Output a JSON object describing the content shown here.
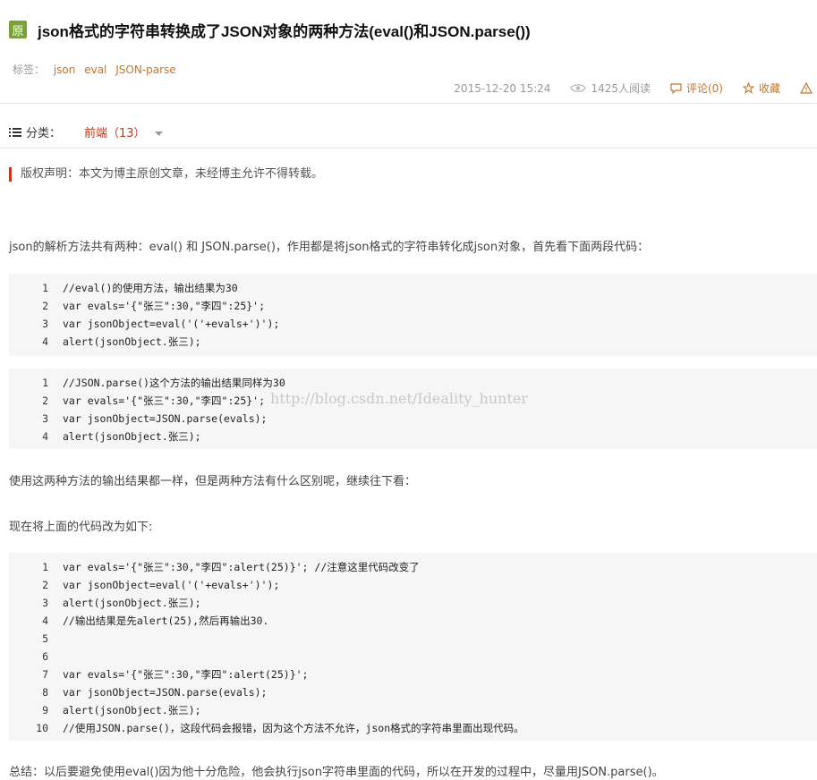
{
  "article": {
    "badge": "原",
    "title": "json格式的字符串转换成了JSON对象的两种方法(eval()和JSON.parse())",
    "tags_label": "标签：",
    "tags": [
      "json",
      "eval",
      "JSON-parse"
    ],
    "date": "2015-12-20 15:24",
    "reads": "1425人阅读",
    "comments": "评论(0)",
    "favorite": "收藏",
    "category_label": "分类：",
    "category_value": "前端（13）",
    "copyright": "版权声明：本文为博主原创文章，未经博主允许不得转载。",
    "para1": "json的解析方法共有两种：eval() 和 JSON.parse()，作用都是将json格式的字符串转化成json对象，首先看下面两段代码：",
    "para2": "使用这两种方法的输出结果都一样，但是两种方法有什么区别呢，继续往下看：",
    "para3": "现在将上面的代码改为如下:",
    "summary": "总结：以后要避免使用eval()因为他十分危险，他会执行json字符串里面的代码，所以在开发的过程中，尽量用JSON.parse()。",
    "watermark": "http://blog.csdn.net/Ideality_hunter"
  },
  "code1": [
    {
      "n": "1",
      "t": "//eval()的使用方法，输出结果为30"
    },
    {
      "n": "2",
      "t": "var evals='{\"张三\":30,\"李四\":25}';"
    },
    {
      "n": "3",
      "t": "var jsonObject=eval('('+evals+')');"
    },
    {
      "n": "4",
      "t": "alert(jsonObject.张三);"
    }
  ],
  "code2": [
    {
      "n": "1",
      "t": "//JSON.parse()这个方法的输出结果同样为30"
    },
    {
      "n": "2",
      "t": "var evals='{\"张三\":30,\"李四\":25}';"
    },
    {
      "n": "3",
      "t": "var jsonObject=JSON.parse(evals);"
    },
    {
      "n": "4",
      "t": "alert(jsonObject.张三);"
    }
  ],
  "code3": [
    {
      "n": "1",
      "t": "var evals='{\"张三\":30,\"李四\":alert(25)}'; //注意这里代码改变了"
    },
    {
      "n": "2",
      "t": "var jsonObject=eval('('+evals+')');"
    },
    {
      "n": "3",
      "t": "alert(jsonObject.张三);"
    },
    {
      "n": "4",
      "t": "//输出结果是先alert(25),然后再输出30."
    },
    {
      "n": "5",
      "t": ""
    },
    {
      "n": "6",
      "t": ""
    },
    {
      "n": "7",
      "t": "var evals='{\"张三\":30,\"李四\":alert(25)}';"
    },
    {
      "n": "8",
      "t": "var jsonObject=JSON.parse(evals);"
    },
    {
      "n": "9",
      "t": "alert(jsonObject.张三);"
    },
    {
      "n": "10",
      "t": "//使用JSON.parse()，这段代码会报错，因为这个方法不允许，json格式的字符串里面出现代码。"
    }
  ]
}
